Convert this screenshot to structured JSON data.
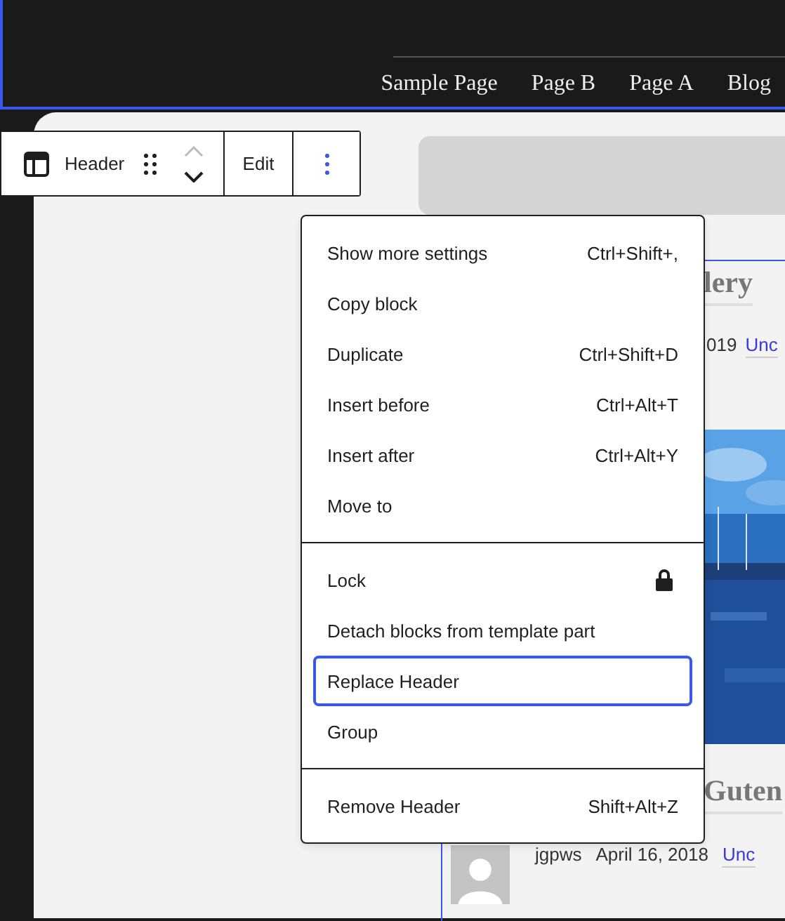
{
  "header": {
    "nav": [
      "Sample Page",
      "Page B",
      "Page A",
      "Blog"
    ]
  },
  "toolbar": {
    "block_label": "Header",
    "edit": "Edit"
  },
  "menu": {
    "sections": [
      [
        {
          "kind": "shortcut",
          "label": "Show more settings",
          "shortcut": "Ctrl+Shift+,",
          "selected": false
        },
        {
          "kind": "plain",
          "label": "Copy block",
          "selected": false
        },
        {
          "kind": "shortcut",
          "label": "Duplicate",
          "shortcut": "Ctrl+Shift+D",
          "selected": false
        },
        {
          "kind": "shortcut",
          "label": "Insert before",
          "shortcut": "Ctrl+Alt+T",
          "selected": false
        },
        {
          "kind": "shortcut",
          "label": "Insert after",
          "shortcut": "Ctrl+Alt+Y",
          "selected": false
        },
        {
          "kind": "plain",
          "label": "Move to",
          "selected": false
        }
      ],
      [
        {
          "kind": "lock",
          "label": "Lock",
          "selected": false
        },
        {
          "kind": "plain",
          "label": "Detach blocks from template part",
          "selected": false
        },
        {
          "kind": "plain",
          "label": "Replace Header",
          "selected": true
        },
        {
          "kind": "plain",
          "label": "Group",
          "selected": false
        }
      ],
      [
        {
          "kind": "shortcut",
          "label": "Remove Header",
          "shortcut": "Shift+Alt+Z",
          "selected": false
        }
      ]
    ]
  },
  "posts": [
    {
      "title": "lery",
      "date": "019",
      "category": "Unc"
    },
    {
      "title": "Guten",
      "author": "jgpws",
      "date": "April 16, 2018",
      "category": "Unc"
    }
  ]
}
